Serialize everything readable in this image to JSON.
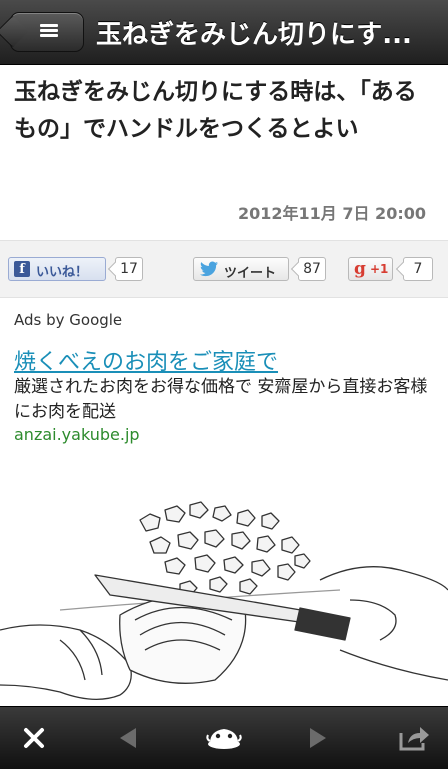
{
  "header": {
    "title": "玉ねぎをみじん切りにす..."
  },
  "article": {
    "title": "玉ねぎをみじん切りにする時は、「あるもの」でハンドルをつくるとよい",
    "date": "2012年11月 7日  20:00"
  },
  "social": {
    "facebook": {
      "icon": "f",
      "label": "いいね！",
      "count": "17"
    },
    "twitter": {
      "label": "ツイート",
      "count": "87"
    },
    "google": {
      "icon": "g",
      "label": "+1",
      "count": "7"
    }
  },
  "ad": {
    "label": "Ads by Google",
    "headline": "焼くべえのお肉をご家庭で",
    "description": "厳選されたお肉をお得な価格で 安齋屋から直接お客様にお肉を配送",
    "url": "anzai.yakube.jp"
  },
  "toolbar": {
    "icons": [
      "close-icon",
      "back-icon",
      "app-logo-icon",
      "forward-icon",
      "share-icon"
    ]
  },
  "colors": {
    "navbar": "#2b2b2b",
    "ad_link": "#1a8fb8",
    "ad_url": "#2d8b2d",
    "facebook": "#3b5998",
    "twitter": "#4aa3df",
    "google": "#d73d32"
  }
}
